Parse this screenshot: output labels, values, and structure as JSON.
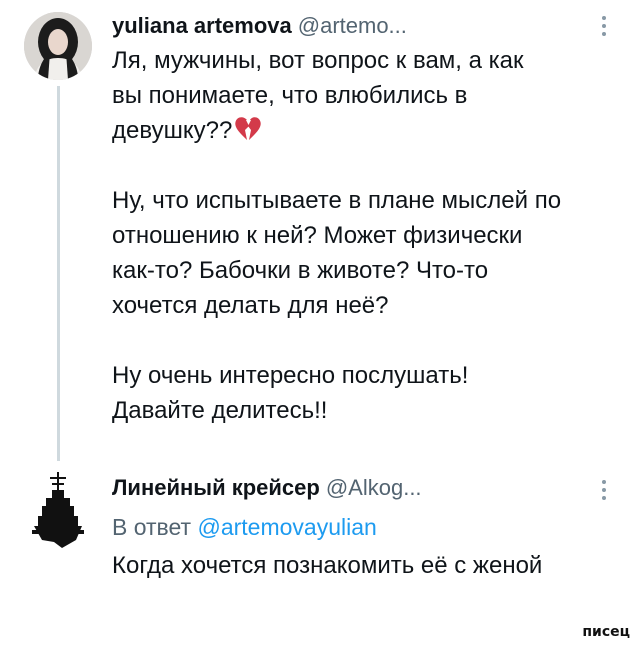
{
  "tweet": {
    "author_name": "yuliana artemova",
    "author_handle": "@artemo...",
    "paragraphs": [
      [
        "Ля, мужчины, вот вопрос к вам, а как",
        "вы понимаете, что влюбились в",
        "девушку??"
      ],
      [
        "Ну, что испытываете в плане мыслей по",
        "отношению к ней? Может физически",
        "как-то? Бабочки в животе? Что-то",
        "хочется делать для неё?"
      ],
      [
        "Ну очень интересно послушать!",
        "Давайте делитесь!!"
      ]
    ],
    "emoji_icon": "broken-heart-icon",
    "avatar": "woman-portrait-avatar",
    "more_icon": "more-options-icon"
  },
  "reply": {
    "author_name": "Линейный крейсер",
    "author_handle": "@Alkog...",
    "reply_prefix": "В ответ",
    "reply_mention": "@artemovayulian",
    "text": "Когда хочется познакомить её с женой",
    "avatar": "battlecruiser-ship-avatar",
    "more_icon": "more-options-icon"
  },
  "watermark": "писец",
  "colors": {
    "text": "#0f1419",
    "secondary": "#536471",
    "link": "#1d9bf0",
    "thread_line": "#cfd9de",
    "broken_heart": "#d33a4a"
  }
}
